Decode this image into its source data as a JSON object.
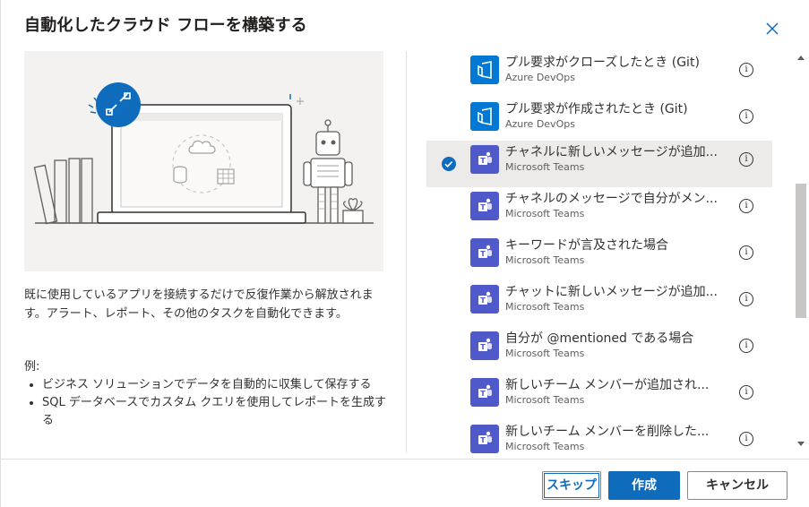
{
  "dialog": {
    "title": "自動化したクラウド フローを構築する",
    "close_icon": "close-icon"
  },
  "left": {
    "description": "既に使用しているアプリを接続するだけで反復作業から解放されます。アラート、レポート、その他のタスクを自動化できます。",
    "examples_label": "例:",
    "examples": [
      "ビジネス ソリューションでデータを自動的に収集して保存する",
      "SQL データベースでカスタム クエリを使用してレポートを生成する"
    ]
  },
  "triggers": [
    {
      "title": "プル要求がクローズしたとき (Git)",
      "app": "Azure DevOps",
      "icon": "azure-devops-icon",
      "selected": false
    },
    {
      "title": "プル要求が作成されたとき (Git)",
      "app": "Azure DevOps",
      "icon": "azure-devops-icon",
      "selected": false
    },
    {
      "title": "チャネルに新しいメッセージが追加...",
      "app": "Microsoft Teams",
      "icon": "teams-icon",
      "selected": true
    },
    {
      "title": "チャネルのメッセージで自分がメン...",
      "app": "Microsoft Teams",
      "icon": "teams-icon",
      "selected": false
    },
    {
      "title": "キーワードが言及された場合",
      "app": "Microsoft Teams",
      "icon": "teams-icon",
      "selected": false
    },
    {
      "title": "チャットに新しいメッセージが追加...",
      "app": "Microsoft Teams",
      "icon": "teams-icon",
      "selected": false
    },
    {
      "title": "自分が @mentioned である場合",
      "app": "Microsoft Teams",
      "icon": "teams-icon",
      "selected": false
    },
    {
      "title": "新しいチーム メンバーが追加され...",
      "app": "Microsoft Teams",
      "icon": "teams-icon",
      "selected": false
    },
    {
      "title": "新しいチーム メンバーを削除した...",
      "app": "Microsoft Teams",
      "icon": "teams-icon",
      "selected": false
    }
  ],
  "buttons": {
    "skip": "スキップ",
    "create": "作成",
    "cancel": "キャンセル"
  },
  "colors": {
    "accent": "#0f6cbd",
    "devops": "#0078d4",
    "teams": "#5059c9",
    "selected_row": "#edebe9"
  }
}
